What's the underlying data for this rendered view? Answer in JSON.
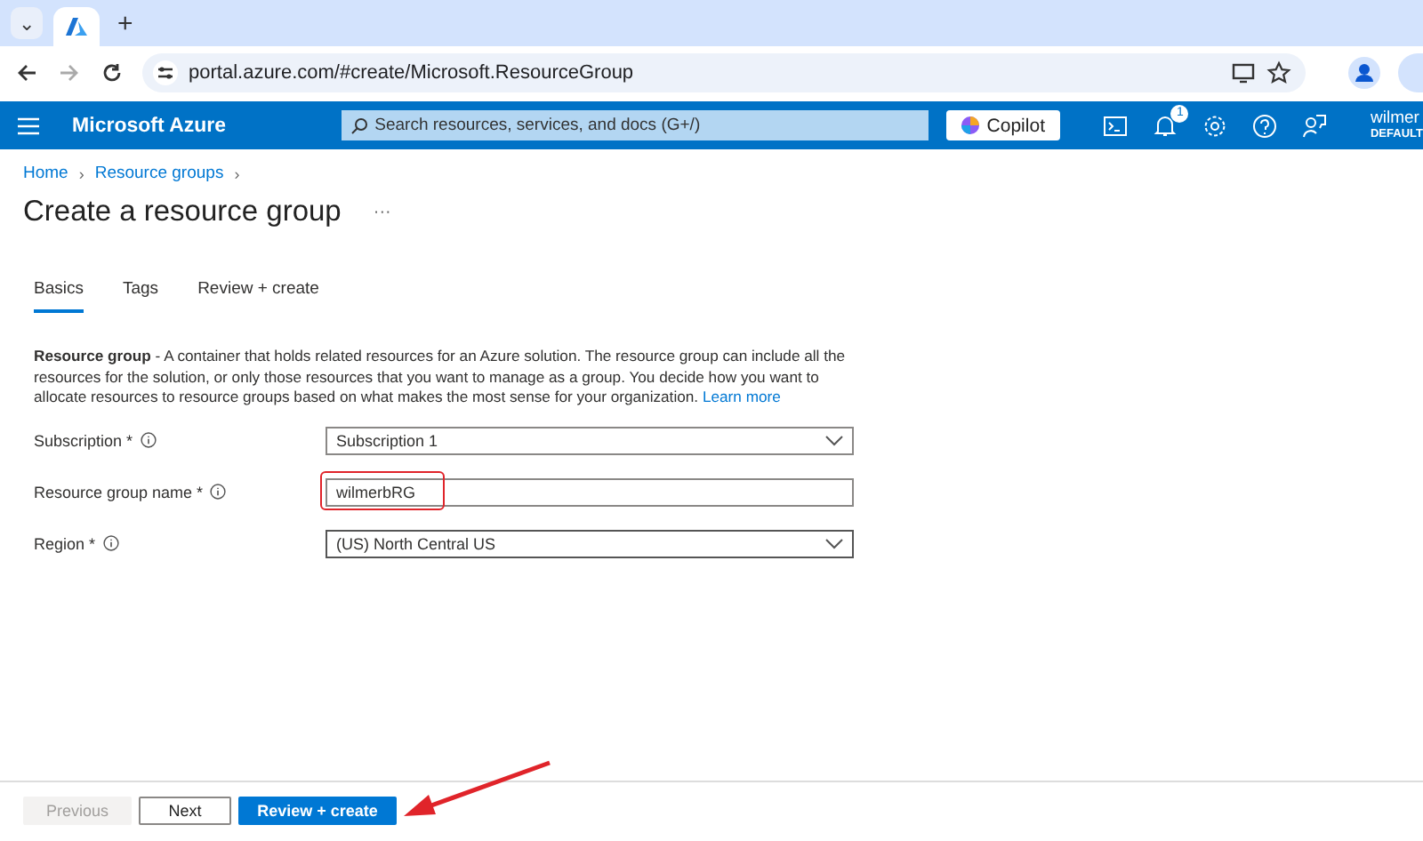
{
  "browser": {
    "tab_count_icon": "⌄",
    "new_tab": "+",
    "url": "portal.azure.com/#create/Microsoft.ResourceGroup"
  },
  "topbar": {
    "brand": "Microsoft Azure",
    "search": {
      "placeholder": "Search resources, services, and docs (G+/)"
    },
    "copilot": "Copilot",
    "notification_count": "1",
    "user": "wilmer",
    "directory": "DEFAULT"
  },
  "breadcrumb": [
    {
      "label": "Home",
      "separator": "›"
    },
    {
      "label": "Resource groups",
      "separator": "›"
    }
  ],
  "title": "Create a resource group",
  "more": "···",
  "tabs": [
    {
      "label": "Basics",
      "selected": true
    },
    {
      "label": "Tags",
      "selected": false
    },
    {
      "label": "Review + create",
      "selected": false
    }
  ],
  "description": {
    "text": "**Resource group** - A container that holds related resources for an Azure solution. The resource group can include all the resources for the solution, or only those resources that you want to manage as a group. You decide how you want to allocate resources to resource groups based on what makes the most sense for your organization.",
    "link": "Learn more"
  },
  "fields": [
    {
      "kind": "select",
      "label": "Subscription *",
      "value": "Subscription 1",
      "highlighted": false,
      "focused": false
    },
    {
      "kind": "text",
      "label": "Resource group name *",
      "value": "wilmerbRG",
      "highlighted": true,
      "focused": false
    },
    {
      "kind": "select",
      "label": "Region *",
      "value": "(US) North Central US",
      "highlighted": false,
      "focused": true
    }
  ],
  "footer_buttons": [
    {
      "label": "Previous",
      "kind": "secondary",
      "disabled": true,
      "pointed": false
    },
    {
      "label": "Next",
      "kind": "secondary",
      "disabled": false,
      "pointed": false
    },
    {
      "label": "Review + create",
      "kind": "primary",
      "disabled": false,
      "pointed": true
    }
  ]
}
